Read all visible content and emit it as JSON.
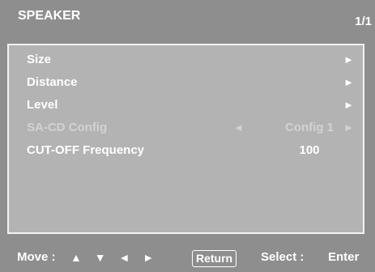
{
  "header": {
    "title": "SPEAKER",
    "page_indicator": "1/1"
  },
  "menu": {
    "items": [
      {
        "label": "Size",
        "arrow": "►",
        "enabled": true
      },
      {
        "label": "Distance",
        "arrow": "►",
        "enabled": true
      },
      {
        "label": "Level",
        "arrow": "►",
        "enabled": true
      },
      {
        "label": "SA-CD Config",
        "left_arrow": "◄",
        "value": "Config 1",
        "arrow": "►",
        "enabled": false
      },
      {
        "label": "CUT-OFF Frequency",
        "value": "100",
        "enabled": true
      }
    ]
  },
  "footer": {
    "move_label": "Move :",
    "move_arrows": "▲ ▼ ◄ ►",
    "return_label": "Return",
    "select_label": "Select :",
    "enter_label": "Enter"
  },
  "colors": {
    "background": "#8e8e8e",
    "panel": "#b3b3b3",
    "text": "#ffffff",
    "disabled_text": "#d2d2d2"
  }
}
